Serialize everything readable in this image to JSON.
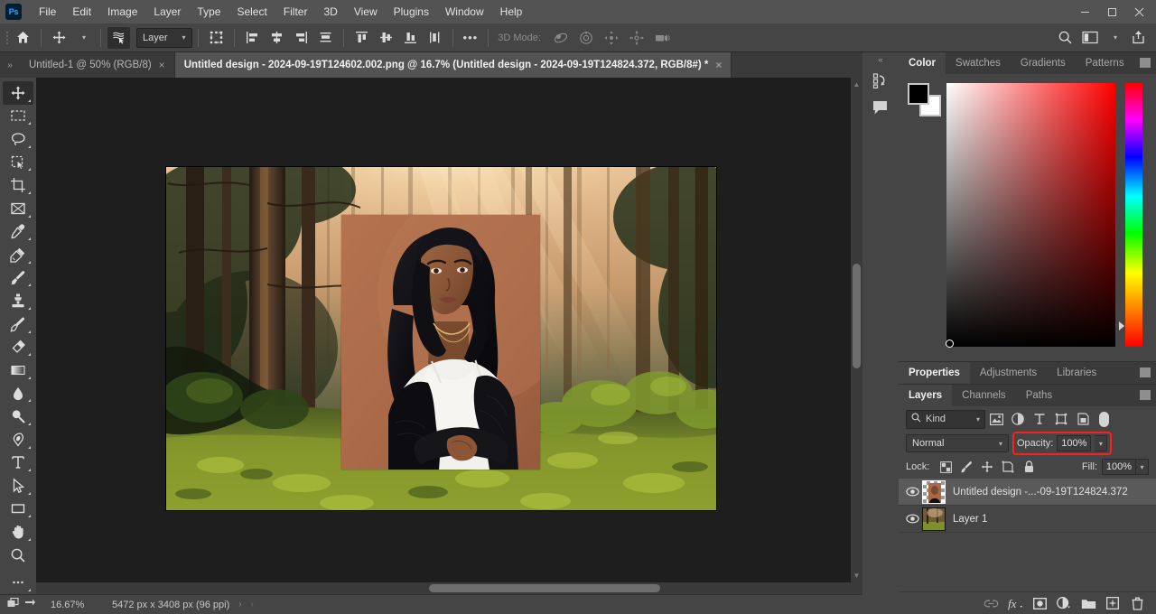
{
  "app": {
    "name": "Adobe Photoshop",
    "logo_text": "Ps"
  },
  "menubar": {
    "items": [
      "File",
      "Edit",
      "Image",
      "Layer",
      "Type",
      "Select",
      "Filter",
      "3D",
      "View",
      "Plugins",
      "Window",
      "Help"
    ],
    "window_controls": [
      "minimize",
      "maximize",
      "close"
    ]
  },
  "options_bar": {
    "home_icon": "home-icon",
    "tool_icon": "move-tool-icon",
    "auto_select_icon": "auto-select-layers-icon",
    "layer_dropdown": "Layer",
    "transform_controls_icon": "show-transform-controls-icon",
    "align_icons": [
      "align-left-edges",
      "align-horizontal-centers",
      "align-right-edges",
      "distribute-horizontally"
    ],
    "distribute_icons": [
      "align-top-edges",
      "align-vertical-centers",
      "align-bottom-edges",
      "distribute-vertically"
    ],
    "more_label": "•••",
    "three_d_label": "3D Mode:",
    "three_d_icons": [
      "orbit-3d-icon",
      "roll-3d-icon",
      "pan-3d-icon",
      "slide-3d-icon",
      "camera-3d-icon"
    ],
    "right_icons": [
      "search-icon",
      "workspace-icon",
      "share-icon"
    ]
  },
  "tabs": [
    {
      "label": "Untitled-1 @ 50% (RGB/8)",
      "active": false,
      "close": "×"
    },
    {
      "label": "Untitled design - 2024-09-19T124602.002.png @ 16.7% (Untitled design - 2024-09-19T124824.372, RGB/8#) *",
      "active": true,
      "close": "×"
    }
  ],
  "toolbar": {
    "tools": [
      {
        "name": "move-tool",
        "selected": true
      },
      {
        "name": "rectangular-marquee-tool",
        "selected": false
      },
      {
        "name": "lasso-tool",
        "selected": false
      },
      {
        "name": "object-selection-tool",
        "selected": false
      },
      {
        "name": "crop-tool",
        "selected": false
      },
      {
        "name": "frame-tool",
        "selected": false
      },
      {
        "name": "eyedropper-tool",
        "selected": false
      },
      {
        "name": "spot-healing-brush-tool",
        "selected": false
      },
      {
        "name": "brush-tool",
        "selected": false
      },
      {
        "name": "clone-stamp-tool",
        "selected": false
      },
      {
        "name": "history-brush-tool",
        "selected": false
      },
      {
        "name": "eraser-tool",
        "selected": false
      },
      {
        "name": "gradient-tool",
        "selected": false
      },
      {
        "name": "blur-tool",
        "selected": false
      },
      {
        "name": "dodge-tool",
        "selected": false
      },
      {
        "name": "pen-tool",
        "selected": false
      },
      {
        "name": "horizontal-type-tool",
        "selected": false
      },
      {
        "name": "path-selection-tool",
        "selected": false
      },
      {
        "name": "rectangle-tool",
        "selected": false
      },
      {
        "name": "hand-tool",
        "selected": false
      },
      {
        "name": "zoom-tool",
        "selected": false
      },
      {
        "name": "edit-toolbar",
        "selected": false
      }
    ]
  },
  "statusbar": {
    "zoom": "16.67%",
    "dimensions": "5472 px x 3408 px (96 ppi)",
    "chevron_right": "›",
    "chevron_left": "‹"
  },
  "mini_dock": {
    "collapse_icon": "collapse-panels-icon",
    "buttons": [
      "history-icon",
      "comments-icon"
    ]
  },
  "color_panel": {
    "tabs": [
      "Color",
      "Swatches",
      "Gradients",
      "Patterns"
    ],
    "active_tab": "Color",
    "foreground_color": "#000000",
    "background_color": "#ffffff",
    "picker_hue": "#ff0000",
    "menu_icon": "panel-menu-icon"
  },
  "properties_panel": {
    "tabs": [
      "Properties",
      "Adjustments",
      "Libraries"
    ],
    "active_tab": "Properties",
    "menu_icon": "panel-menu-icon"
  },
  "layers_panel": {
    "tabs": [
      "Layers",
      "Channels",
      "Paths"
    ],
    "active_tab": "Layers",
    "menu_icon": "panel-menu-icon",
    "filter": {
      "kind_label": "Kind",
      "search_icon": "search-icon",
      "filter_icons": [
        "pixel-layers-filter",
        "adjustment-layers-filter",
        "type-layers-filter",
        "shape-layers-filter",
        "smart-object-filter"
      ],
      "toggle_name": "filter-toggle"
    },
    "blend_mode": "Normal",
    "opacity_label": "Opacity:",
    "opacity_value": "100%",
    "opacity_highlight_color": "#ff1e1e",
    "lock_label": "Lock:",
    "lock_icons": [
      "lock-transparent-pixels",
      "lock-image-pixels",
      "lock-position",
      "lock-artboard-nesting",
      "lock-all"
    ],
    "fill_label": "Fill:",
    "fill_value": "100%",
    "layers": [
      {
        "name": "Untitled design -...-09-19T124824.372",
        "visible": true,
        "selected": true,
        "thumb": "portrait-thumb"
      },
      {
        "name": "Layer 1",
        "visible": true,
        "selected": false,
        "thumb": "forest-thumb"
      }
    ],
    "footer_buttons": [
      "link-layers-icon",
      "add-layer-style-icon",
      "add-layer-mask-icon",
      "new-adjustment-layer-icon",
      "new-group-icon",
      "new-layer-icon",
      "delete-layer-icon"
    ]
  },
  "canvas": {
    "document_name": "Untitled design - 2024-09-19T124602.002.png",
    "zoom_percent": "16.7%",
    "background_layer_description": "sunlit pine forest with mossy green floor",
    "overlay_layer_description": "studio portrait of a woman on a warm brown backdrop"
  }
}
